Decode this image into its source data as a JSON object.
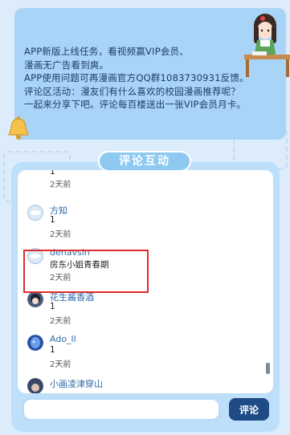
{
  "notice": {
    "lines": [
      "APP新版上线任务，看视频赢VIP会员、",
      "漫画无广告看到爽。",
      "APP使用问题可再漫画官方QQ群1083730931反馈。",
      "评论区活动：漫友们有什么喜欢的校园漫画推荐呢？",
      "一起来分享下吧。评论每百楼送出一张VIP会员月卡。"
    ]
  },
  "section": {
    "title": "评论互动"
  },
  "comments": [
    {
      "name": "",
      "text": "1",
      "time": "2天前",
      "avatar": "cut"
    },
    {
      "name": "方知",
      "text": "1",
      "time": "2天前",
      "avatar": "blank"
    },
    {
      "name": "denavsin",
      "text": "房东小姐青春期",
      "time": "2天前",
      "avatar": "blank"
    },
    {
      "name": "花生酱香酒",
      "text": "1",
      "time": "2天前",
      "avatar": "anime"
    },
    {
      "name": "Ado_ll",
      "text": "1",
      "time": "2天前",
      "avatar": "anime-blue"
    },
    {
      "name": "小画凌津穿山",
      "text": "",
      "time": "",
      "avatar": "anime"
    }
  ],
  "input": {
    "placeholder": "",
    "value": ""
  },
  "submit": {
    "label": "评论"
  },
  "colors": {
    "accent": "#1e4b86",
    "highlight": "#e02b2b",
    "panel": "#a8d4f7"
  }
}
